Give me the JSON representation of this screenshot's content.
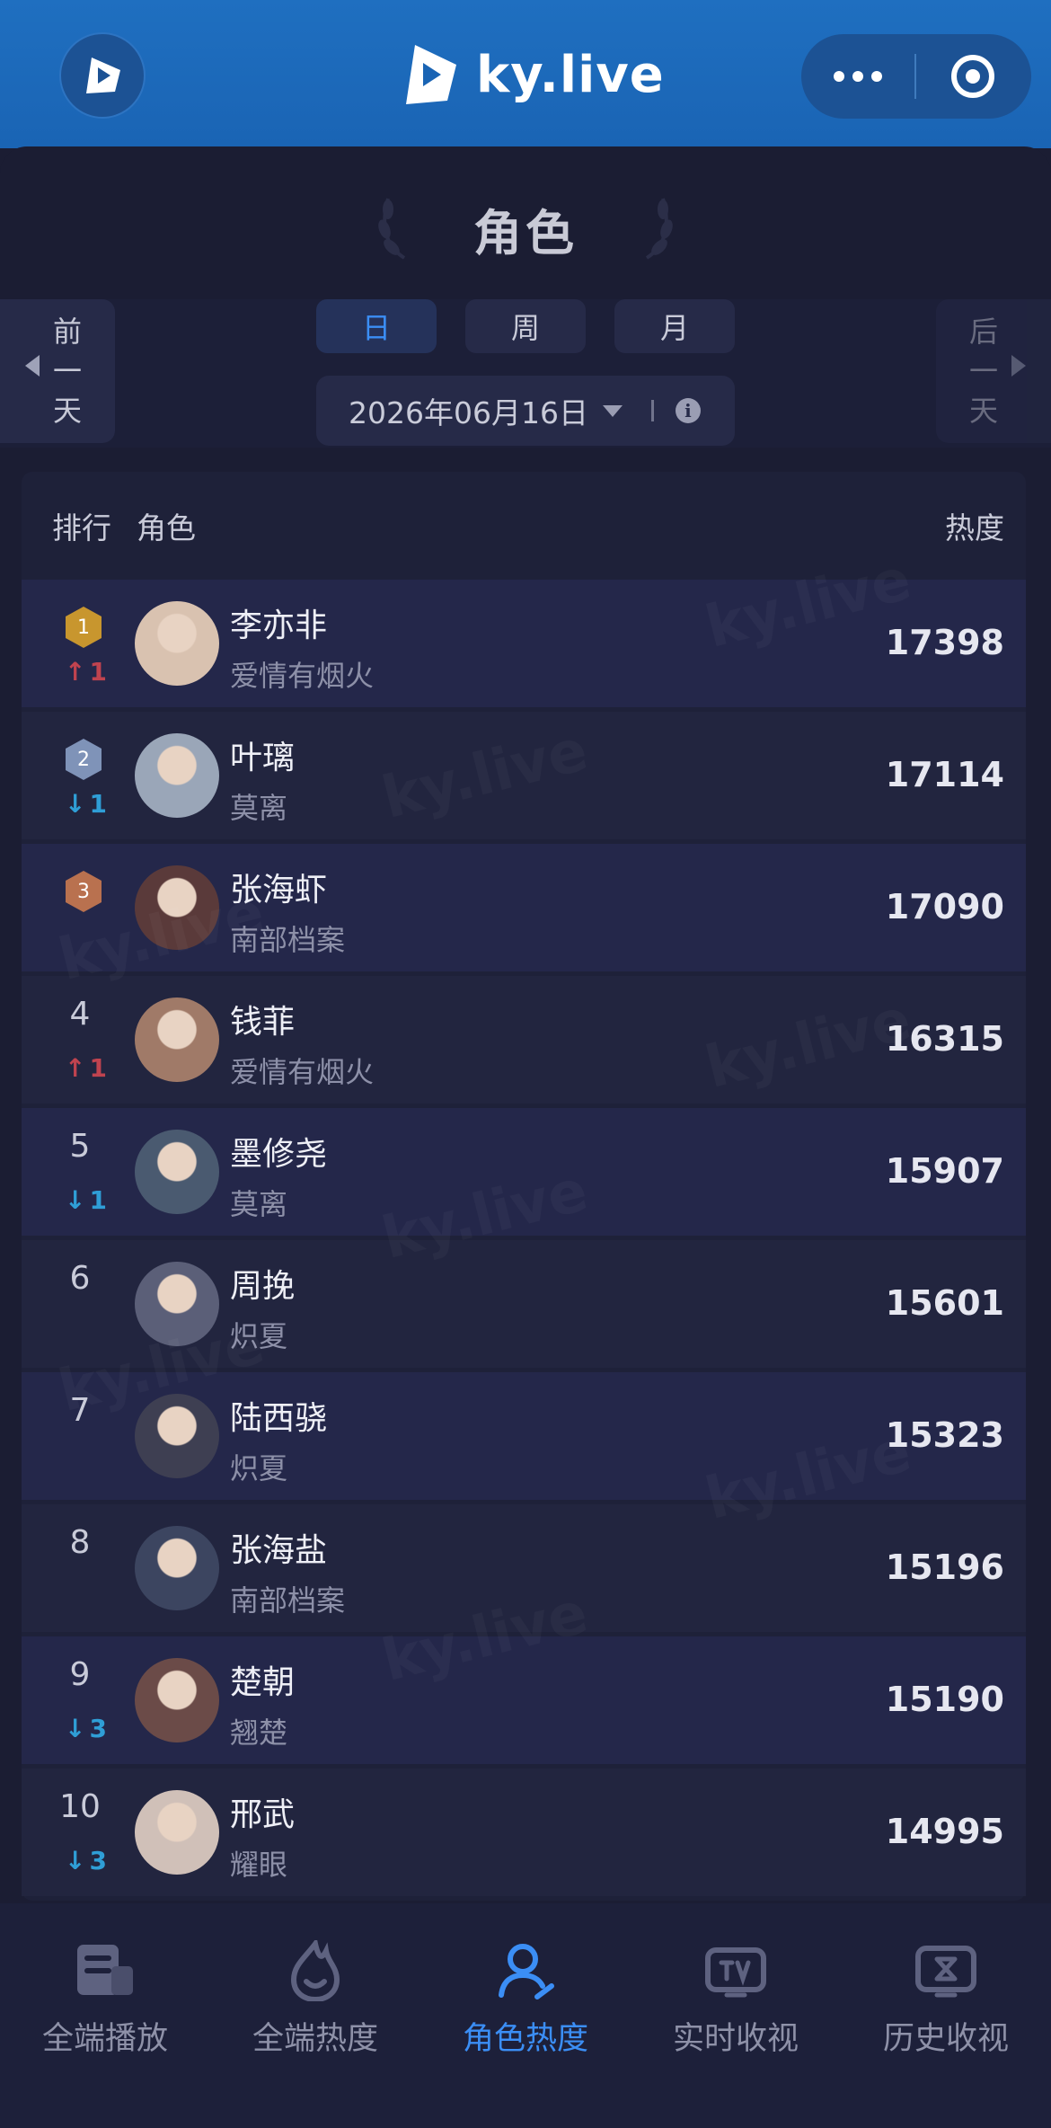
{
  "app": {
    "logo_text": "ky.live",
    "brand_color": "#1a64b4",
    "accent_color": "#3b8ef5"
  },
  "header": {
    "title": "角色"
  },
  "period": {
    "prev_label": "前一天",
    "next_label": "后一天",
    "tabs": [
      {
        "label": "日",
        "active": true
      },
      {
        "label": "周",
        "active": false
      },
      {
        "label": "月",
        "active": false
      }
    ],
    "date": "2026年06月16日"
  },
  "table": {
    "col_rank": "排行",
    "col_role": "角色",
    "col_heat": "热度",
    "rows": [
      {
        "rank": "1",
        "medal": "gold",
        "change_dir": "up",
        "change": "1",
        "name": "李亦非",
        "drama": "爱情有烟火",
        "heat": "17398"
      },
      {
        "rank": "2",
        "medal": "silver",
        "change_dir": "down",
        "change": "1",
        "name": "叶璃",
        "drama": "莫离",
        "heat": "17114"
      },
      {
        "rank": "3",
        "medal": "bronze",
        "change_dir": "",
        "change": "",
        "name": "张海虾",
        "drama": "南部档案",
        "heat": "17090"
      },
      {
        "rank": "4",
        "medal": "",
        "change_dir": "up",
        "change": "1",
        "name": "钱菲",
        "drama": "爱情有烟火",
        "heat": "16315"
      },
      {
        "rank": "5",
        "medal": "",
        "change_dir": "down",
        "change": "1",
        "name": "墨修尧",
        "drama": "莫离",
        "heat": "15907"
      },
      {
        "rank": "6",
        "medal": "",
        "change_dir": "",
        "change": "",
        "name": "周挽",
        "drama": "炽夏",
        "heat": "15601"
      },
      {
        "rank": "7",
        "medal": "",
        "change_dir": "",
        "change": "",
        "name": "陆西骁",
        "drama": "炽夏",
        "heat": "15323"
      },
      {
        "rank": "8",
        "medal": "",
        "change_dir": "",
        "change": "",
        "name": "张海盐",
        "drama": "南部档案",
        "heat": "15196"
      },
      {
        "rank": "9",
        "medal": "",
        "change_dir": "down",
        "change": "3",
        "name": "楚朝",
        "drama": "翘楚",
        "heat": "15190"
      },
      {
        "rank": "10",
        "medal": "",
        "change_dir": "down",
        "change": "3",
        "name": "邢武",
        "drama": "耀眼",
        "heat": "14995"
      }
    ]
  },
  "nav": {
    "items": [
      {
        "label": "全端播放",
        "icon": "playback-icon",
        "active": false
      },
      {
        "label": "全端热度",
        "icon": "flame-icon",
        "active": false
      },
      {
        "label": "角色热度",
        "icon": "user-icon",
        "active": true
      },
      {
        "label": "实时收视",
        "icon": "tv-icon",
        "active": false
      },
      {
        "label": "历史收视",
        "icon": "history-icon",
        "active": false
      }
    ]
  }
}
